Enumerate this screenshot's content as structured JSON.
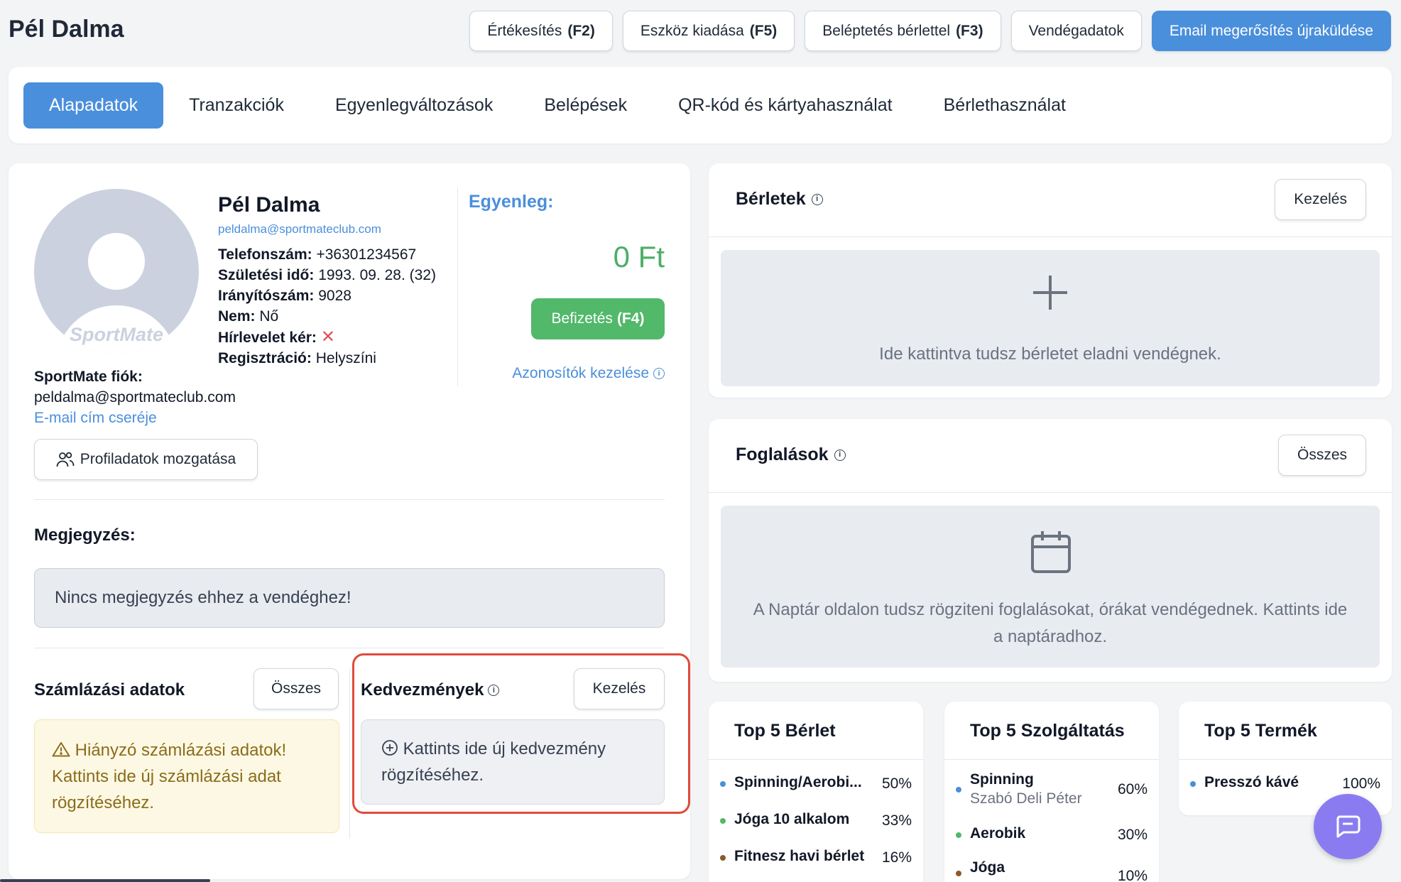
{
  "header": {
    "title": "Pél Dalma",
    "actions": [
      {
        "label": "Értékesítés",
        "key": "(F2)"
      },
      {
        "label": "Eszköz kiadása",
        "key": "(F5)"
      },
      {
        "label": "Beléptetés bérlettel",
        "key": "(F3)"
      },
      {
        "label": "Vendégadatok",
        "key": ""
      },
      {
        "label": "Email megerősítés újraküldése",
        "key": ""
      }
    ]
  },
  "tabs": [
    {
      "label": "Alapadatok",
      "active": true
    },
    {
      "label": "Tranzakciók"
    },
    {
      "label": "Egyenlegváltozások"
    },
    {
      "label": "Belépések"
    },
    {
      "label": "QR-kód és kártyahasználat"
    },
    {
      "label": "Bérlethasználat"
    }
  ],
  "profile": {
    "avatar_logo": "SportMate",
    "name": "Pél Dalma",
    "email": "peldalma@sportmateclub.com",
    "fields": [
      {
        "label": "Telefonszám:",
        "value": "+36301234567"
      },
      {
        "label": "Születési idő:",
        "value": "1993. 09. 28. (32)"
      },
      {
        "label": "Irányítószám:",
        "value": "9028"
      },
      {
        "label": "Nem:",
        "value": "Nő"
      },
      {
        "label": "Hírlevelet kér:",
        "value": "✕"
      },
      {
        "label": "Regisztráció:",
        "value": "Helyszíni"
      }
    ],
    "balance_label": "Egyenleg:",
    "balance_value": "0 Ft",
    "pay_label": "Befizetés",
    "pay_key": "(F4)",
    "id_manage_link": "Azonosítók kezelése",
    "sportmate_label": "SportMate fiók:",
    "sportmate_email": "peldalma@sportmateclub.com",
    "email_change_link": "E-mail cím cseréje",
    "move_button": "Profiladatok mozgatása"
  },
  "notes": {
    "title": "Megjegyzés:",
    "text": "Nincs megjegyzés ehhez a vendéghez!"
  },
  "billing": {
    "title": "Számlázási adatok",
    "button": "Összes",
    "warning_line1": "Hiányzó számlázási adatok!",
    "warning_line2": "Kattints ide új számlázási adat rögzítéséhez."
  },
  "discounts": {
    "title": "Kedvezmények",
    "button": "Kezelés",
    "text": "Kattints ide új kedvezmény rögzítéséhez."
  },
  "passes": {
    "title": "Bérletek",
    "button": "Kezelés",
    "empty_text": "Ide kattintva tudsz bérletet eladni vendégnek."
  },
  "bookings": {
    "title": "Foglalások",
    "button": "Összes",
    "empty_text": "A Naptár oldalon tudsz rögziteni foglalásokat, órákat vendégednek. Kattints ide a naptáradhoz."
  },
  "top_passes": {
    "title": "Top 5 Bérlet",
    "items": [
      {
        "label": "Spinning/Aerobi...",
        "pct": "50%",
        "color": "#4a8fdb"
      },
      {
        "label": "Jóga 10 alkalom",
        "pct": "33%",
        "color": "#52b86a"
      },
      {
        "label": "Fitnesz havi bérlet",
        "pct": "16%",
        "color": "#8b5a2b"
      }
    ]
  },
  "top_services": {
    "title": "Top 5 Szolgáltatás",
    "items": [
      {
        "label": "Spinning",
        "sub": "Szabó Deli Péter",
        "pct": "60%",
        "color": "#4a8fdb"
      },
      {
        "label": "Aerobik",
        "pct": "30%",
        "color": "#52b86a"
      },
      {
        "label": "Jóga",
        "pct": "10%",
        "color": "#8b5a2b"
      }
    ]
  },
  "top_products": {
    "title": "Top 5 Termék",
    "items": [
      {
        "label": "Presszó kávé",
        "pct": "100%",
        "color": "#4a8fdb"
      }
    ]
  },
  "colors": {
    "primary": "#4a8fdb",
    "success": "#52b86a",
    "highlight": "#e04a3b",
    "chat": "#8a7cf0"
  }
}
